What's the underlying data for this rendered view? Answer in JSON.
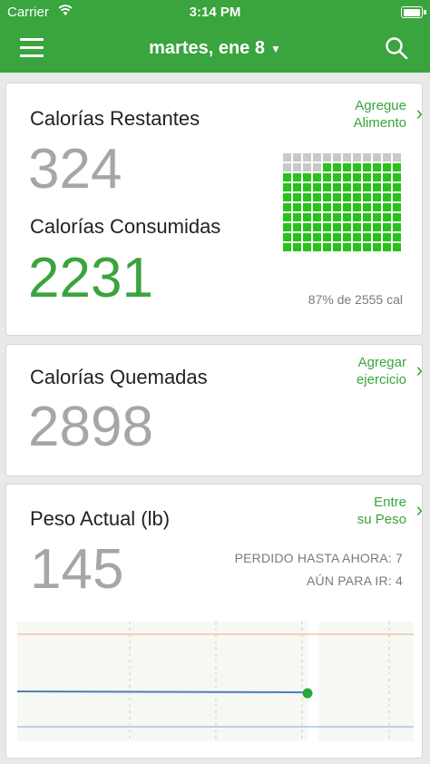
{
  "status": {
    "carrier": "Carrier",
    "time": "3:14 PM"
  },
  "nav": {
    "title": "martes, ene 8",
    "icons": [
      "menu-icon",
      "search-icon",
      "chevron-down-icon"
    ]
  },
  "calories": {
    "remaining_label": "Calorías Restantes",
    "remaining_value": "324",
    "consumed_label": "Calorías Consumidas",
    "consumed_value": "2231",
    "add_food_line1": "Agregue",
    "add_food_line2": "Alimento",
    "progress_text": "87% de 2555 cal",
    "progress_fraction": 0.87,
    "grid_cells": 120,
    "filled_cells": 104
  },
  "burned": {
    "label": "Calorías Quemadas",
    "value": "2898",
    "add_exercise_line1": "Agregar",
    "add_exercise_line2": "ejercicio"
  },
  "weight": {
    "label": "Peso Actual (lb)",
    "value": "145",
    "enter_line1": "Entre",
    "enter_line2": "su Peso",
    "lost_text": "PERDIDO HASTA AHORA: 7",
    "to_go_text": "AÚN PARA IR: 4"
  },
  "colors": {
    "brand_green": "#3aa43e",
    "cell_green": "#27c21a",
    "cell_gray": "#c9c9c9",
    "line_blue": "#4a7ec2",
    "goal_line_orange": "#f0c8a0",
    "start_line_blue": "#a9c3e4"
  }
}
